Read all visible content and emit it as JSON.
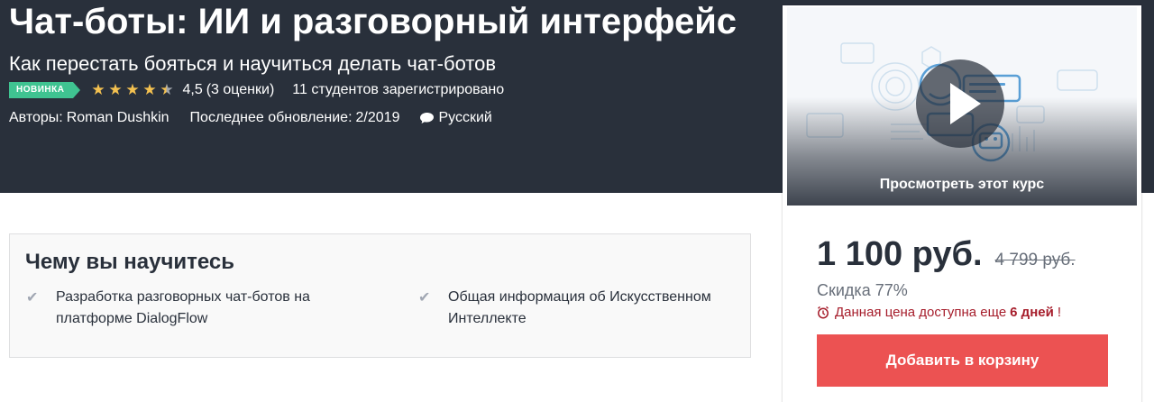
{
  "course": {
    "title": "Чат-боты: ИИ и разговорный интерфейс",
    "subtitle": "Как перестать бояться и научиться делать чат-ботов",
    "badge": "НОВИНКА",
    "rating_value": "4,5",
    "rating_count": "(3 оценки)",
    "rating_stars": 4.5,
    "students": "11 студентов зарегистрировано",
    "authors_label": "Авторы:",
    "author": "Roman Dushkin",
    "updated_label": "Последнее обновление:",
    "updated_value": "2/2019",
    "language": "Русский"
  },
  "learn": {
    "title": "Чему вы научитесь",
    "items": [
      "Разработка разговорных чат-ботов на платформе DialogFlow",
      "Общая информация об Искусственном Интеллекте"
    ]
  },
  "sidebar": {
    "preview_label": "Просмотреть этот курс",
    "price": "1 100 руб.",
    "old_price": "4 799 руб.",
    "discount": "Скидка 77%",
    "timer_prefix": "Данная цена доступна еще",
    "timer_days": "6 дней",
    "timer_suffix": "!",
    "cart_button": "Добавить в корзину"
  },
  "colors": {
    "hero_bg": "#29303b",
    "badge": "#3fc391",
    "stars": "#f4c150",
    "cart_button": "#ec5252",
    "timer_text": "#a61d2b"
  },
  "icons": [
    "star-icon",
    "star-half-icon",
    "speech-bubble-icon",
    "check-icon",
    "play-icon",
    "alarm-clock-icon"
  ]
}
